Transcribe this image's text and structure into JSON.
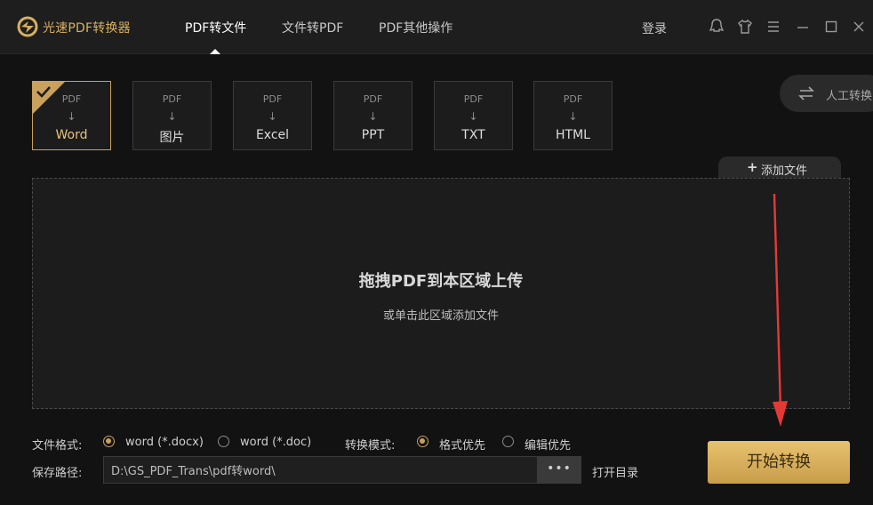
{
  "app": {
    "title": "光速PDF转换器"
  },
  "nav": {
    "tabs": [
      "PDF转文件",
      "文件转PDF",
      "PDF其他操作"
    ],
    "active": 0
  },
  "header": {
    "login": "登录"
  },
  "formats": [
    {
      "top": "PDF",
      "arrow": "↓",
      "label": "Word",
      "selected": true
    },
    {
      "top": "PDF",
      "arrow": "↓",
      "label": "图片"
    },
    {
      "top": "PDF",
      "arrow": "↓",
      "label": "Excel"
    },
    {
      "top": "PDF",
      "arrow": "↓",
      "label": "PPT"
    },
    {
      "top": "PDF",
      "arrow": "↓",
      "label": "TXT"
    },
    {
      "top": "PDF",
      "arrow": "↓",
      "label": "HTML"
    }
  ],
  "manual": {
    "label": "人工转换"
  },
  "add_file": {
    "label": "添加文件"
  },
  "dropzone": {
    "title": "拖拽PDF到本区域上传",
    "subtitle": "或单击此区域添加文件"
  },
  "settings": {
    "format_label": "文件格式:",
    "format_options": [
      "word (*.docx)",
      "word (*.doc)"
    ],
    "format_selected": 0,
    "mode_label": "转换模式:",
    "mode_options": [
      "格式优先",
      "编辑优先"
    ],
    "mode_selected": 0,
    "path_label": "保存路径:",
    "path_value": "D:\\GS_PDF_Trans\\pdf转word\\",
    "browse": "•••",
    "open_dir": "打开目录"
  },
  "start_button": "开始转换",
  "colors": {
    "accent": "#c9a15d",
    "background": "#121212",
    "annotation": "#e53935"
  }
}
